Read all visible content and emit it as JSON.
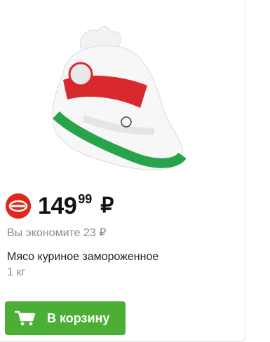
{
  "product": {
    "image_icon": "frozen-chicken-package",
    "price_main": "149",
    "price_cents": "99",
    "currency": "₽",
    "savings_text": "Вы экономите 23 ₽",
    "name": "Мясо куриное замороженное",
    "weight": "1 кг"
  },
  "actions": {
    "add_to_cart_label": "В корзину",
    "cart_icon": "shopping-cart-icon"
  },
  "colors": {
    "accent_green": "#4caf35",
    "promo_red": "#e1261c",
    "muted_text": "#8c8c8c"
  }
}
